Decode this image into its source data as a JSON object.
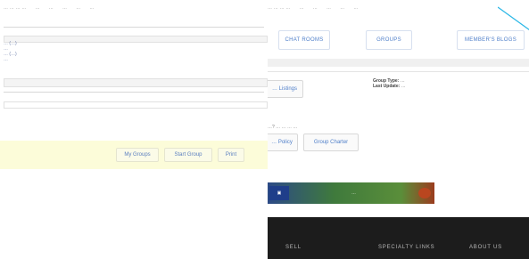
{
  "left_pane": {
    "topnav": [
      "… … … …",
      "…",
      "…",
      "…",
      "…",
      "…"
    ],
    "list_items": [
      "… (…)",
      "…",
      "… (…)",
      "…"
    ],
    "buttons": {
      "my_groups": "My Groups",
      "start_group": "Start Group",
      "print": "Print"
    }
  },
  "right_pane": {
    "topnav": [
      "… … … …",
      "…",
      "…",
      "…",
      "…",
      "…"
    ],
    "tabs": [
      "CHAT ROOMS",
      "GROUPS",
      "MEMBER'S BLOGS"
    ],
    "listings_button": "… Listings",
    "group_info": {
      "type_label": "Group Type:",
      "type_value": "…",
      "updated_label": "Last Update:",
      "updated_value": "…"
    },
    "note": "…? … … … …",
    "policy_button": "… Policy",
    "charter_button": "Group Charter",
    "banner_text": "…",
    "footer_links": [
      "SELL",
      "SPECIALTY LINKS",
      "ABOUT US"
    ]
  },
  "colors": {
    "accent": "#4f7fc9",
    "highlight_bar": "#fcfcd9",
    "footer": "#1c1c1c",
    "diagonal": "#2ab7e6"
  }
}
